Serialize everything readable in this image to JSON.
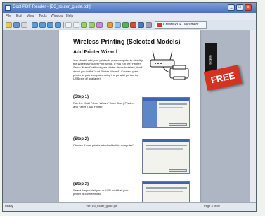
{
  "window": {
    "title": "Cool PDF Reader - [D3_router_guide.pdf]",
    "minimize": "_",
    "maximize": "□",
    "close": "x"
  },
  "menu": [
    "File",
    "Edit",
    "View",
    "Tools",
    "Window",
    "Help"
  ],
  "toolbar": {
    "create_pdf_label": "Create PDF Document"
  },
  "document": {
    "title": "Wireless Printing (Selected Models)",
    "section": "Add Printer Wizard",
    "intro": "You should add your printer to your computer to simplify the Wireless Router Print Setup. If you run the \"Printer Setup Wizard\" without your printer driver installed, it will direct you to the \"Add Printer Wizard\". Connect your printer to your computer using the parallel port or the USB port (if available).",
    "tab_label": "English",
    "steps": [
      {
        "label": "(Step 1)",
        "text": "Run the \"Add Printer Wizard\" from Start | Printers and Faxes | Add Printer."
      },
      {
        "label": "(Step 2)",
        "text": "Choose \"Local printer attached to this computer\"."
      },
      {
        "label": "(Step 3)",
        "text": "Select the parallel port or USB port that your printer is connected to."
      }
    ]
  },
  "badge": "FREE",
  "status": {
    "left": "Ready",
    "file": "File: D3_router_guide.pdf",
    "page": "Page 3 of 50"
  }
}
